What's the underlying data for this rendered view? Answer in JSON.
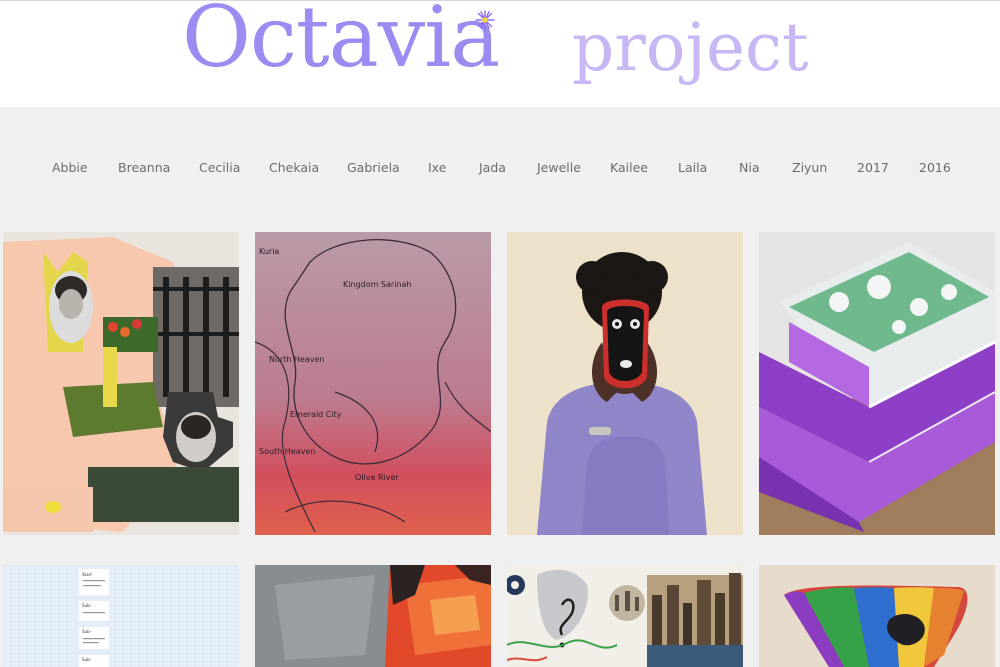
{
  "site": {
    "title_main": "Octavia",
    "title_sub": "project",
    "colors": {
      "title_main": "#9b8cf2",
      "title_sub": "#c7b8f3",
      "nav_text": "#6c6c6c",
      "background": "#f0f0f0"
    }
  },
  "nav": {
    "items": [
      "Abbie",
      "Breanna",
      "Cecilia",
      "Chekaia",
      "Gabriela",
      "Ixe",
      "Jada",
      "Jewelle",
      "Kailee",
      "Laila",
      "Nia",
      "Ziyun",
      "2017",
      "2016"
    ]
  },
  "gallery": {
    "map_labels": [
      "Kuria",
      "Kingdom Sarinah",
      "North Heaven",
      "Emerald City",
      "South Heaven",
      "Olive River"
    ],
    "note_labels": [
      "Start",
      "Sub-",
      "Sub-",
      "Sub-"
    ],
    "tiles": [
      {
        "subject": "collage-portraits"
      },
      {
        "subject": "map-drawing"
      },
      {
        "subject": "person-with-mask"
      },
      {
        "subject": "purple-sculpture"
      },
      {
        "subject": "flowchart-notes"
      },
      {
        "subject": "abstract-painting"
      },
      {
        "subject": "city-collage"
      },
      {
        "subject": "rainbow-sculpture"
      }
    ]
  }
}
